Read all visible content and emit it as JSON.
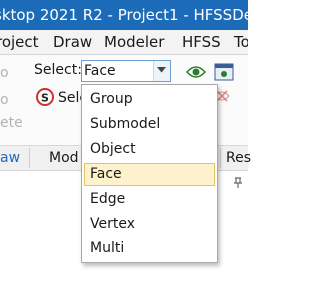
{
  "window": {
    "title": "sktop 2021 R2 - Project1 - HFSSDe"
  },
  "menubar": {
    "items": [
      "roject",
      "Draw",
      "Modeler",
      "HFSS",
      "To"
    ]
  },
  "ribbon": {
    "select_label": "Select:",
    "select_value": "Face",
    "select_partial_text": "Sele",
    "ghost_labels": [
      "o",
      "o",
      "ete"
    ]
  },
  "groups": {
    "labels": [
      "aw",
      "Mod",
      "Res"
    ]
  },
  "dropdown": {
    "options": [
      "Group",
      "Submodel",
      "Object",
      "Face",
      "Edge",
      "Vertex",
      "Multi"
    ],
    "selected": "Face"
  },
  "colors": {
    "titlebar": "#1b6bb8",
    "accent_border": "#6d9ed6",
    "highlight": "#fdf2cc"
  },
  "icons": {
    "eye": "eye-icon",
    "dropdown_arrow": "chevron-down-icon",
    "select_mode": "select-icon"
  }
}
